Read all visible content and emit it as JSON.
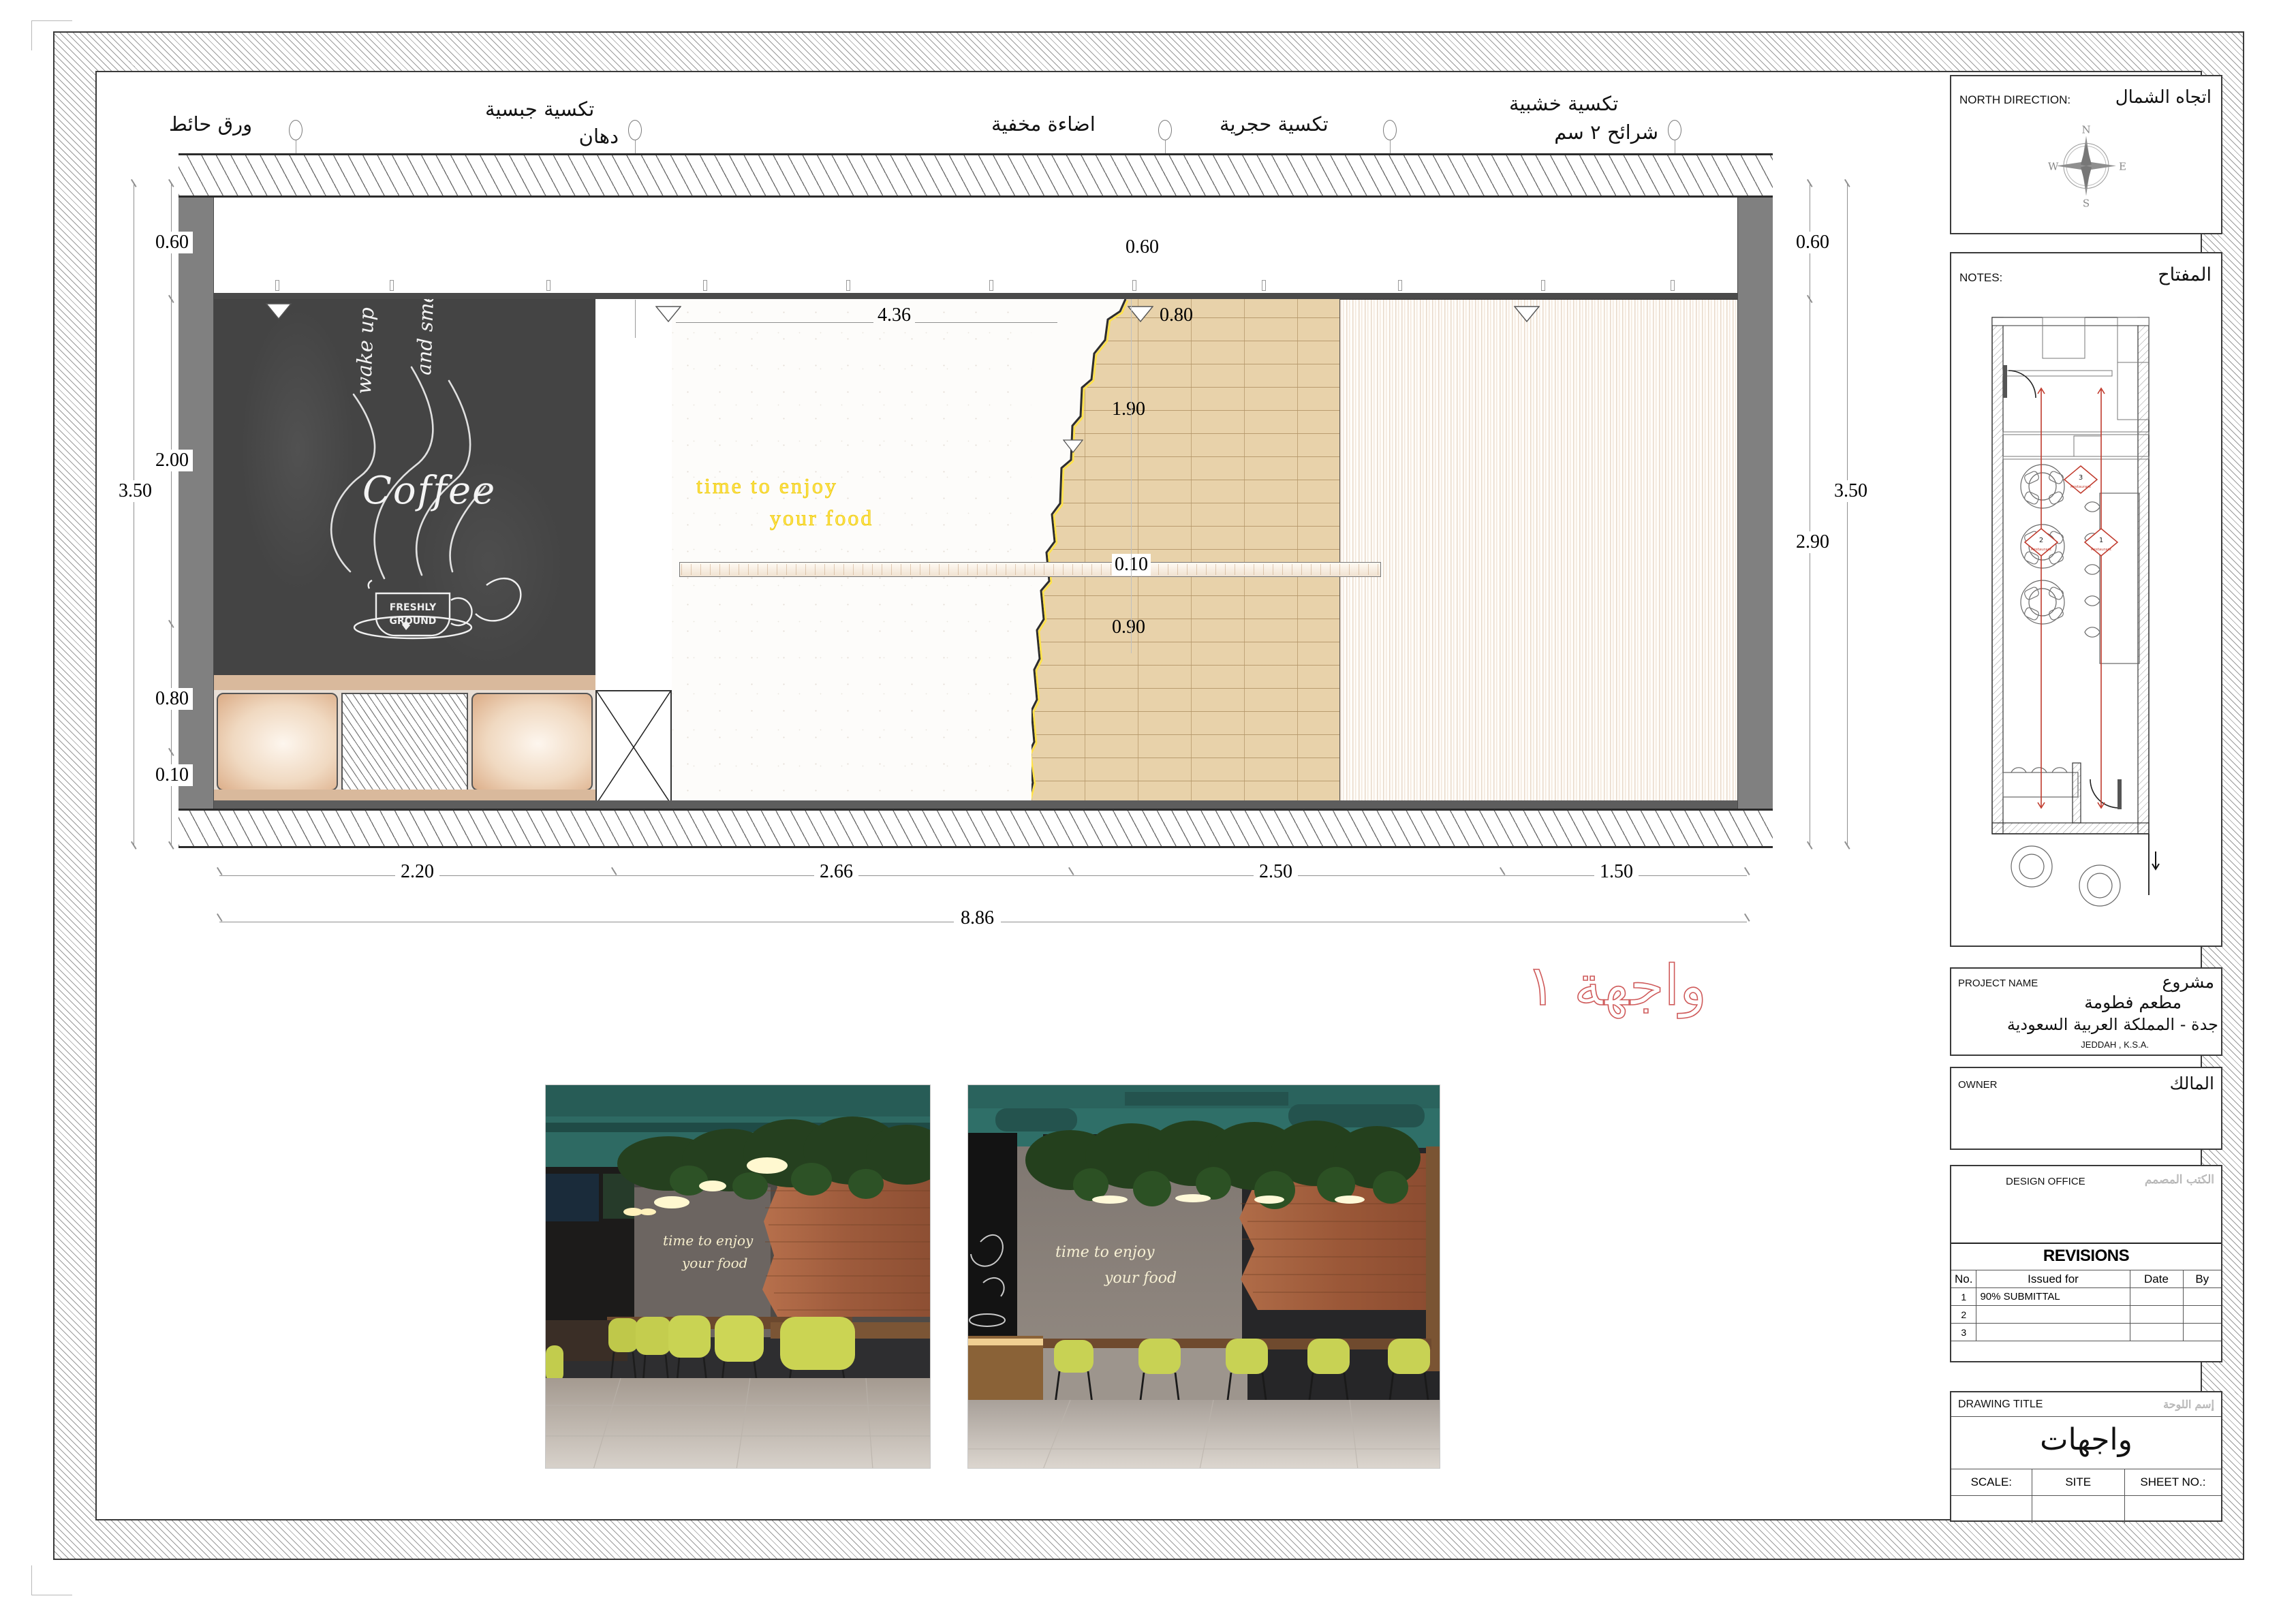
{
  "sheet": {
    "facade_title": "واجهة ١"
  },
  "callouts": [
    {
      "id": "wallpaper",
      "label": "ورق حائط"
    },
    {
      "id": "gypsum",
      "label_1": "تكسية جبسية",
      "label_2": "دهان"
    },
    {
      "id": "hidden-light",
      "label": "اضاءة مخفية"
    },
    {
      "id": "stone-clad",
      "label": "تكسية حجرية"
    },
    {
      "id": "wood-clad",
      "label_1": "تكسية خشبية",
      "label_2": "شرائح ٢ سم"
    }
  ],
  "dimensions": {
    "left": [
      "0.60",
      "2.00",
      "3.50",
      "0.80",
      "0.10"
    ],
    "right": [
      "0.60",
      "3.50",
      "2.90"
    ],
    "bottom_segments": [
      "2.20",
      "2.66",
      "2.50",
      "1.50"
    ],
    "bottom_total": "8.86",
    "interior": [
      "0.60",
      "4.36",
      "0.80",
      "1.90",
      "0.10",
      "0.90"
    ]
  },
  "elevation_text": {
    "neon_line1": "time to enjoy",
    "neon_line2": "your food",
    "chalk_line1": "wake up",
    "chalk_line2": "and smell the",
    "chalk_word": "Coffee",
    "chalk_cup1": "FRESHLY",
    "chalk_cup2": "GROUND"
  },
  "north_panel": {
    "label_en": "NORTH DIRECTION:",
    "label_ar": "اتجاه الشمال",
    "compass": {
      "n": "N",
      "e": "E",
      "s": "S",
      "w": "W"
    }
  },
  "notes_panel": {
    "label_en": "NOTES:",
    "label_ar": "المفتاح",
    "key_markers": [
      "1",
      "2",
      "3"
    ],
    "key_marker_sub": "Restaurant"
  },
  "project_panel": {
    "label_en": "PROJECT NAME",
    "label_ar": "مشروع",
    "name_ar": "مطعم فطومة",
    "location_ar": "جدة - المملكة العربية السعودية",
    "location_en": "JEDDAH , K.S.A."
  },
  "owner_panel": {
    "label_en": "OWNER",
    "label_ar": "المالك"
  },
  "design_office_panel": {
    "label_en": "DESIGN OFFICE",
    "label_ar": "الكتب المصمم"
  },
  "revisions": {
    "title": "REVISIONS",
    "headers": [
      "No.",
      "Issued for",
      "Date",
      "By"
    ],
    "rows": [
      {
        "no": "1",
        "issued_for": "90% SUBMITTAL",
        "date": "",
        "by": ""
      },
      {
        "no": "2",
        "issued_for": "",
        "date": "",
        "by": ""
      },
      {
        "no": "3",
        "issued_for": "",
        "date": "",
        "by": ""
      }
    ]
  },
  "drawing_title_panel": {
    "label_en": "DRAWING TITLE",
    "label_ar": "إسم اللوحة",
    "title_ar": "واجهات",
    "scale_label": "SCALE:",
    "site_label": "SITE",
    "sheet_no_label": "SHEET NO.:",
    "scale_value": "",
    "site_value": "",
    "sheet_no_value": ""
  },
  "colors": {
    "brick": "#e8d2aa",
    "chalkboard": "#444444",
    "neon": "#ffe24a",
    "title_red": "#cf5a5a",
    "wall_grey": "#808080"
  }
}
